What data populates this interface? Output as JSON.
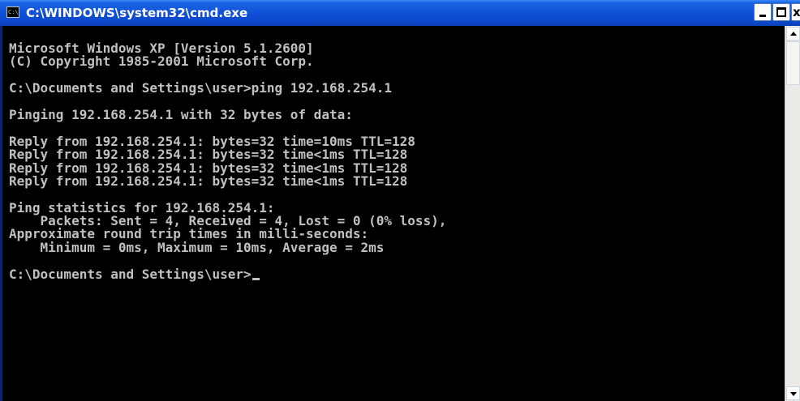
{
  "window": {
    "title": "C:\\WINDOWS\\system32\\cmd.exe",
    "icon": "cmd-icon",
    "controls": {
      "minimize_icon": "minimize-icon",
      "maximize_icon": "maximize-icon",
      "close_icon": "close-icon",
      "close_glyph": "x"
    }
  },
  "console": {
    "background": "#000000",
    "foreground": "#c0c0c0",
    "lines": [
      "Microsoft Windows XP [Version 5.1.2600]",
      "(C) Copyright 1985-2001 Microsoft Corp.",
      "",
      "C:\\Documents and Settings\\user>ping 192.168.254.1",
      "",
      "Pinging 192.168.254.1 with 32 bytes of data:",
      "",
      "Reply from 192.168.254.1: bytes=32 time=10ms TTL=128",
      "Reply from 192.168.254.1: bytes=32 time<1ms TTL=128",
      "Reply from 192.168.254.1: bytes=32 time<1ms TTL=128",
      "Reply from 192.168.254.1: bytes=32 time<1ms TTL=128",
      "",
      "Ping statistics for 192.168.254.1:",
      "    Packets: Sent = 4, Received = 4, Lost = 0 (0% loss),",
      "Approximate round trip times in milli-seconds:",
      "    Minimum = 0ms, Maximum = 10ms, Average = 2ms",
      "",
      "C:\\Documents and Settings\\user>"
    ]
  },
  "scrollbar": {
    "up_icon": "scroll-up-arrow-icon",
    "down_icon": "scroll-down-arrow-icon"
  },
  "colors": {
    "titlebar": "#0f4fd4",
    "console_bg": "#000000",
    "console_fg": "#c0c0c0"
  }
}
